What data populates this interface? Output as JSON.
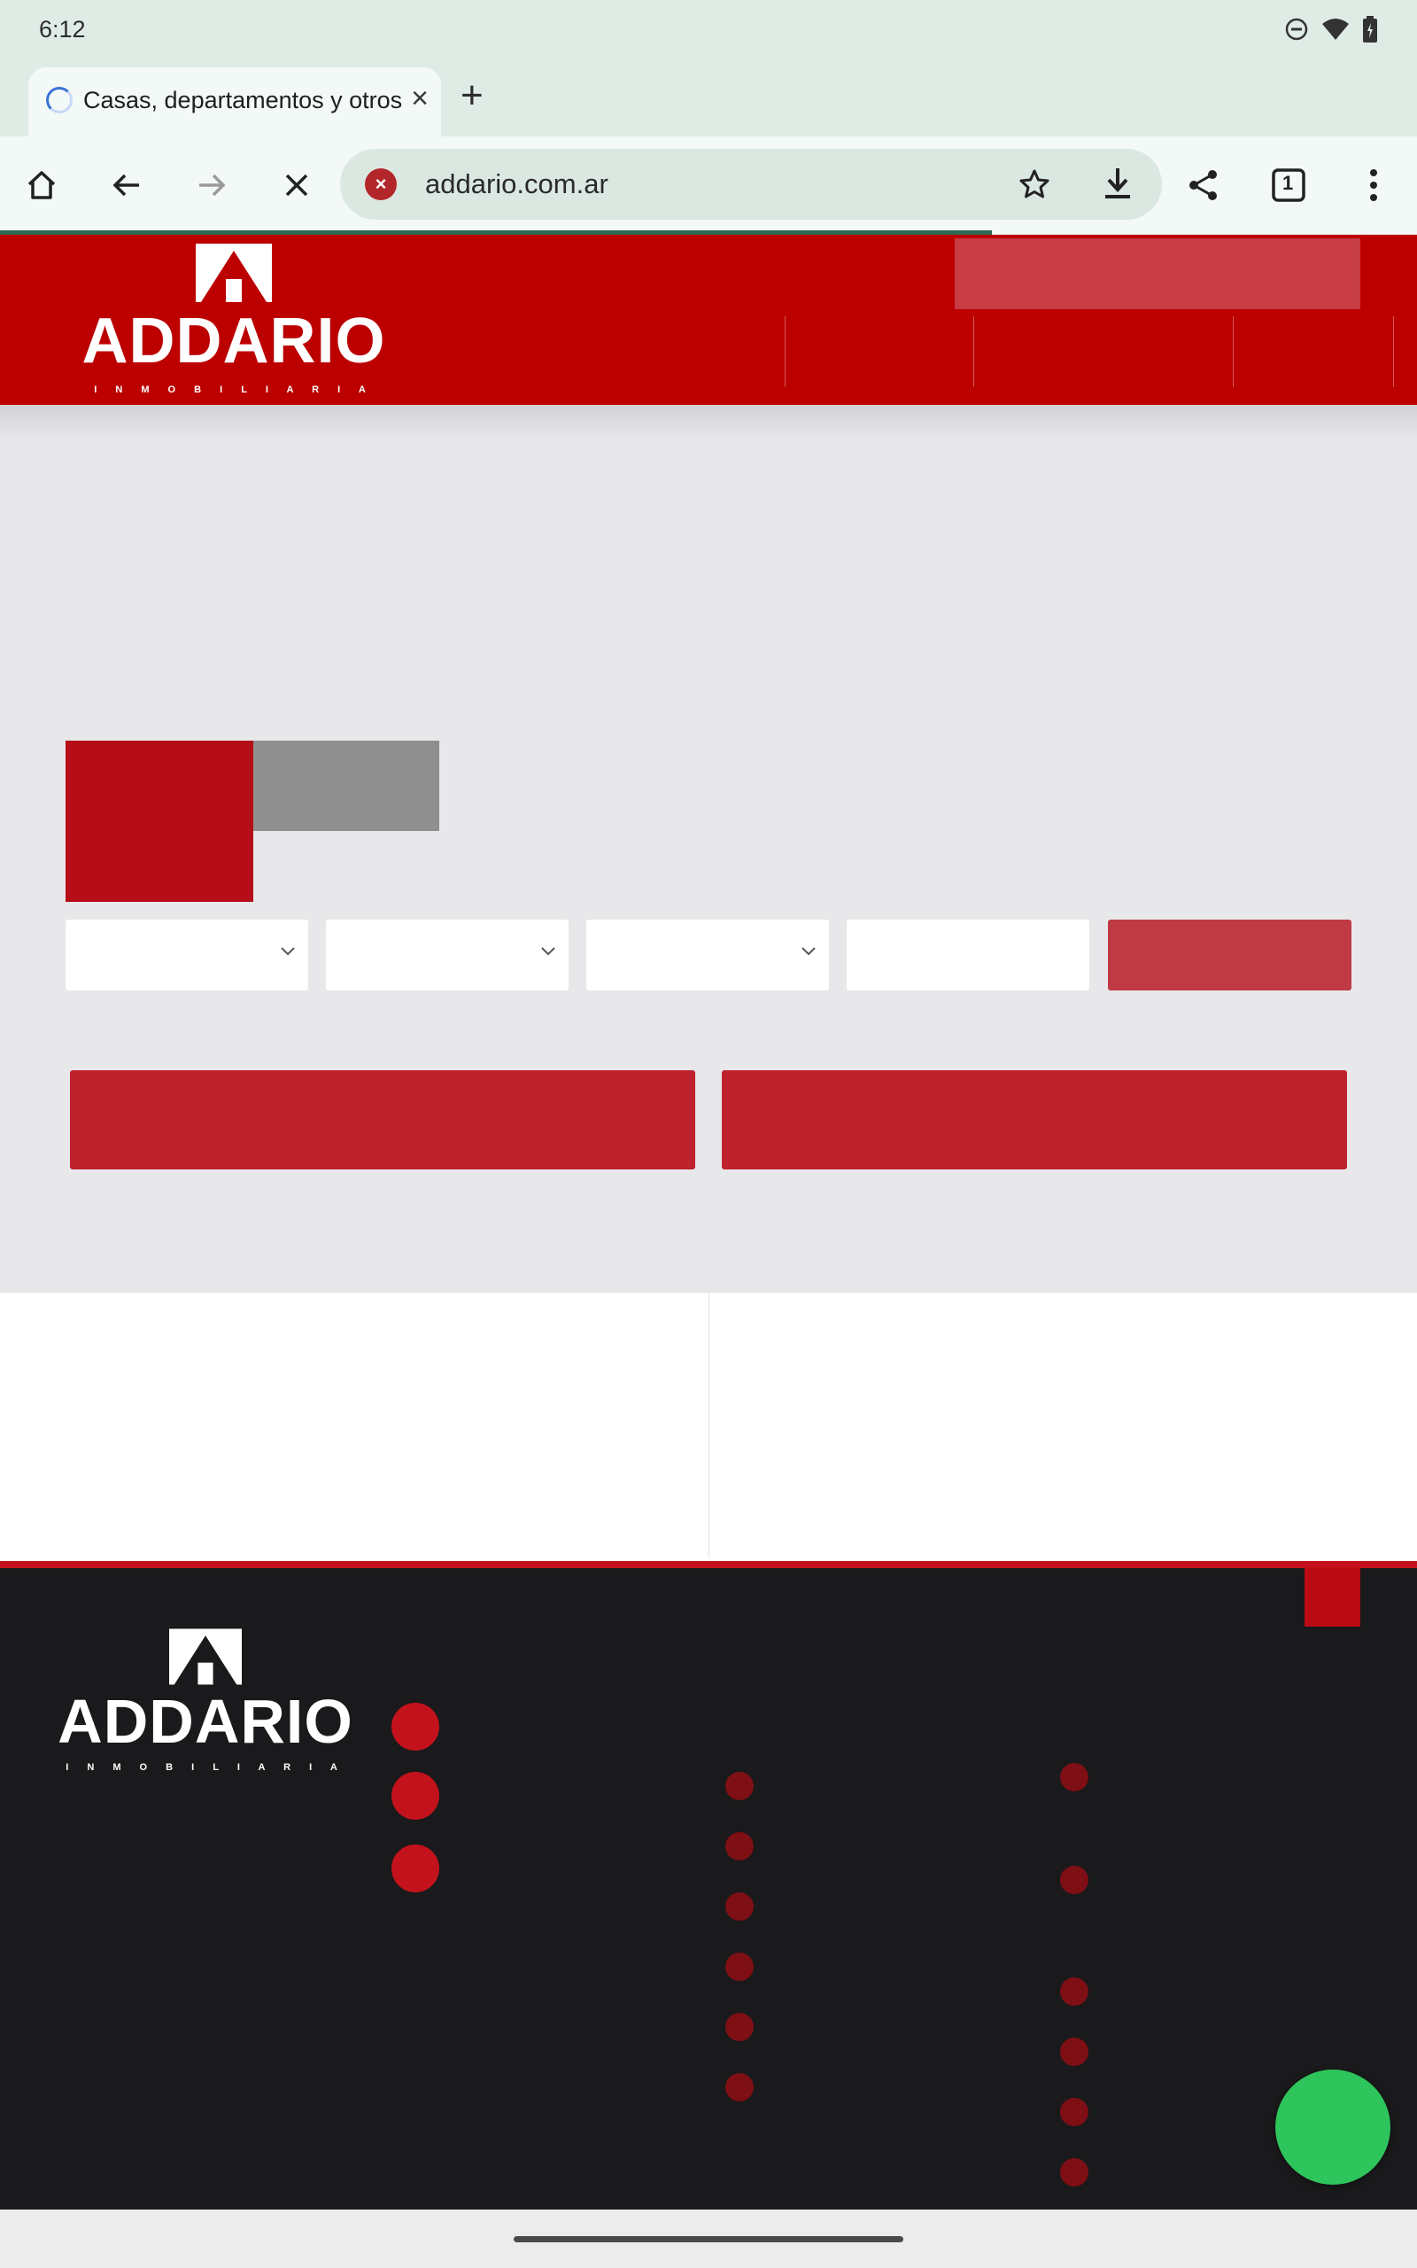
{
  "status_bar": {
    "time": "6:12"
  },
  "browser": {
    "tab_title": "Casas, departamentos y otros",
    "url": "addario.com.ar",
    "tab_count": "1"
  },
  "site": {
    "logo_word": "ADDARIO",
    "logo_subtitle": "I N M O B I L I A R I A"
  },
  "colors": {
    "brand_red": "#bc0000",
    "footer_bg": "#1a191b",
    "whatsapp_green": "#2ec55c"
  }
}
